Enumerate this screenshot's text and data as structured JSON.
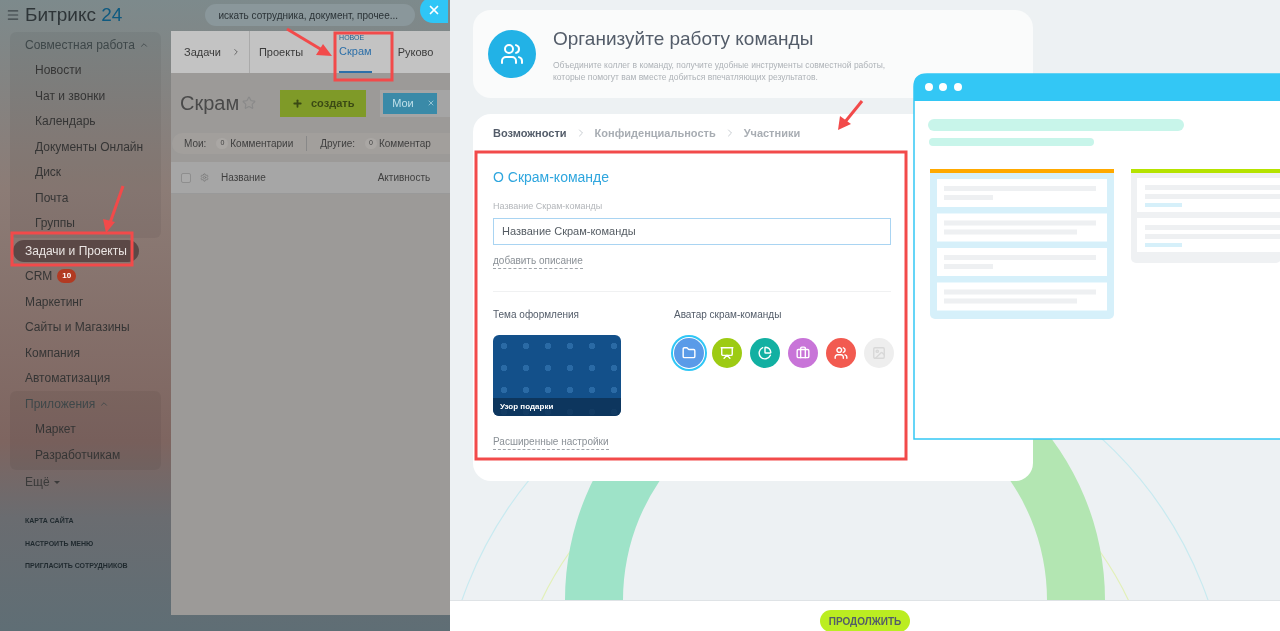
{
  "portal": {
    "header": {
      "logo_text": "Битрикс",
      "logo_number": "24",
      "search": {
        "placeholder": "искать сотрудника, документ, прочее..."
      }
    },
    "sidebar": {
      "items": [
        {
          "kind": "group",
          "label": "Совместная работа",
          "expanded": true,
          "children": [
            {
              "kind": "item",
              "label": "Новости",
              "selected": false
            },
            {
              "kind": "item",
              "label": "Чат и звонки",
              "selected": false
            },
            {
              "kind": "item",
              "label": "Календарь",
              "selected": false
            },
            {
              "kind": "item",
              "label": "Документы Онлайн",
              "selected": false
            },
            {
              "kind": "item",
              "label": "Диск",
              "selected": false
            },
            {
              "kind": "item",
              "label": "Почта",
              "selected": false
            },
            {
              "kind": "item",
              "label": "Группы",
              "selected": false
            }
          ]
        },
        {
          "kind": "item",
          "label": "Задачи и Проекты",
          "selected": true
        },
        {
          "kind": "item",
          "label": "CRM",
          "selected": false,
          "counter": "10"
        },
        {
          "kind": "item",
          "label": "Маркетинг",
          "selected": false
        },
        {
          "kind": "item",
          "label": "Сайты и Магазины",
          "selected": false
        },
        {
          "kind": "item",
          "label": "Компания",
          "selected": false
        },
        {
          "kind": "item",
          "label": "Автоматизация",
          "selected": false
        },
        {
          "kind": "group",
          "label": "Приложения",
          "expanded": true,
          "children": [
            {
              "kind": "item",
              "label": "Маркет",
              "selected": false
            },
            {
              "kind": "item",
              "label": "Разработчикам",
              "selected": false
            }
          ]
        },
        {
          "kind": "more",
          "label": "Ещё"
        }
      ],
      "footer_links": [
        "КАРТА САЙТА",
        "НАСТРОИТЬ МЕНЮ",
        "ПРИГЛАСИТЬ СОТРУДНИКОВ"
      ]
    },
    "tabs": [
      {
        "label": "Задачи",
        "selected": false
      },
      {
        "label": "Проекты",
        "selected": false
      },
      {
        "label": "Скрам",
        "badge": "НОВОЕ",
        "selected": true
      },
      {
        "label": "Руково",
        "selected": false
      }
    ],
    "page_title": "Скрам",
    "favorite": false,
    "create_button": "создать",
    "filter_chip": "Мои",
    "counters": [
      {
        "label": "Мои:",
        "count": "0",
        "text": "Комментарии"
      },
      {
        "label": "Другие:",
        "count": "0",
        "text": "Комментар"
      }
    ],
    "select_all": {
      "checked": false
    },
    "table_columns": [
      "Название",
      "Активность"
    ]
  },
  "slider": {
    "intro": {
      "title": "Организуйте работу команды",
      "description": "Объедините коллег в команду, получите удобные инструменты совместной работы, которые помогут вам вместе добиться впечатляющих результатов."
    },
    "steps": [
      {
        "label": "Возможности",
        "selected": true
      },
      {
        "label": "Конфиденциальность",
        "selected": false
      },
      {
        "label": "Участники",
        "selected": false
      }
    ],
    "form": {
      "section_title": "О Скрам-команде",
      "name_field": {
        "label": "Название Скрам-команды",
        "placeholder": "Название Скрам-команды"
      },
      "add_description_link": "добавить описание",
      "theme": {
        "label": "Тема оформления",
        "name": "Узор подарки"
      },
      "avatar": {
        "label": "Аватар скрам-команды",
        "options": [
          {
            "kind": "folder",
            "color": "#5a9be8",
            "selected": true
          },
          {
            "kind": "presentation",
            "color": "#9dcb13",
            "selected": false
          },
          {
            "kind": "chart",
            "color": "#12b0a2",
            "selected": false
          },
          {
            "kind": "briefcase",
            "color": "#c874d8",
            "selected": false
          },
          {
            "kind": "team",
            "color": "#f25a50",
            "selected": false
          },
          {
            "kind": "image",
            "color": "#eeeeee",
            "selected": false
          }
        ]
      },
      "advanced_link": "Расширенные настройки"
    },
    "continue_button": "ПРОДОЛЖИТЬ"
  }
}
